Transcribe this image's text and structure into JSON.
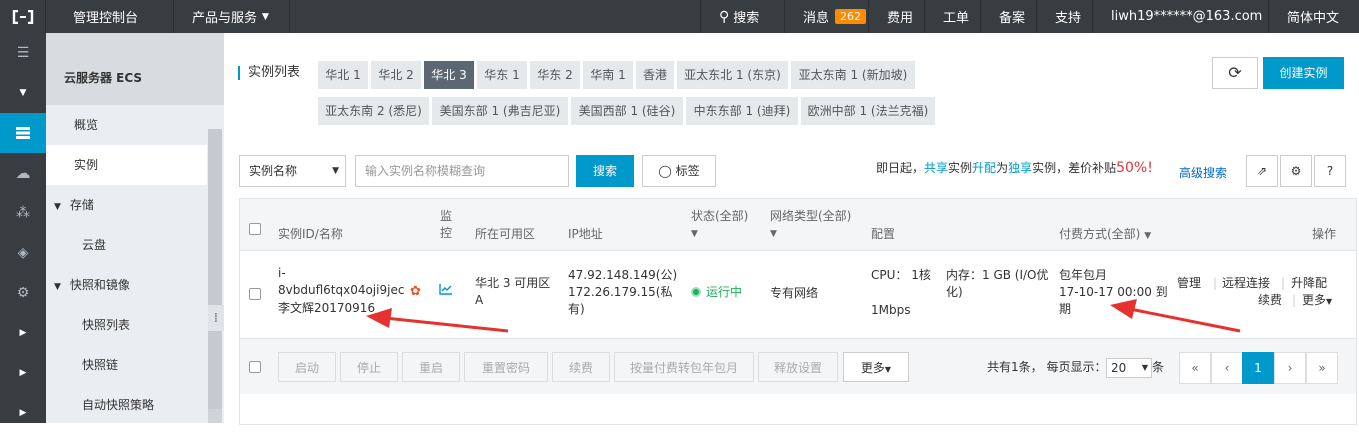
{
  "topbar": {
    "logo": "[-]",
    "brand": "管理控制台",
    "products": "产品与服务",
    "search": "搜索",
    "messages": "消息",
    "message_count": "262",
    "billing": "费用",
    "tickets": "工单",
    "beian": "备案",
    "support": "支持",
    "account": "liwh19******@163.com",
    "language": "简体中文"
  },
  "sidenav": {
    "title": "云服务器 ECS",
    "overview": "概览",
    "instances": "实例",
    "storage": "存储",
    "disk": "云盘",
    "snapshots": "快照和镜像",
    "snapshot_list": "快照列表",
    "snapshot_chain": "快照链",
    "auto_snapshot": "自动快照策略"
  },
  "regions": {
    "label": "实例列表",
    "row1": [
      "华北 1",
      "华北 2",
      "华北 3",
      "华东 1",
      "华东 2",
      "华南 1",
      "香港",
      "亚太东北 1 (东京)",
      "亚太东南 1 (新加坡)"
    ],
    "row2": [
      "亚太东南 2 (悉尼)",
      "美国东部 1 (弗吉尼亚)",
      "美国西部 1 (硅谷)",
      "中东东部 1 (迪拜)",
      "欧洲中部 1 (法兰克福)"
    ],
    "active": "华北 3"
  },
  "toolbar": {
    "refresh": "⟳",
    "create": "创建实例",
    "filter_select": "实例名称",
    "search_placeholder": "输入实例名称模糊查询",
    "search_btn": "搜索",
    "tag_btn": "标签",
    "promo_a": "即日起，",
    "promo_b": "共享",
    "promo_c": "实例",
    "promo_d": "升配",
    "promo_e": "为",
    "promo_f": "独享",
    "promo_g": "实例，差价补贴",
    "promo_pct": "50%!",
    "advanced": "高级搜索",
    "export_icon": "⇗",
    "gear_icon": "⚙",
    "help_icon": "?"
  },
  "table": {
    "headers": {
      "id": "实例ID/名称",
      "monitor": "监控",
      "zone": "所在可用区",
      "ip": "IP地址",
      "status": "状态(全部)",
      "network": "网络类型(全部)",
      "config": "配置",
      "billing": "付费方式(全部)",
      "actions": "操作"
    },
    "row": {
      "id_line1": "i-",
      "id_line2": "8vbdufl6tqx04oji9jec",
      "name": "李文辉20170916",
      "zone": "华北 3 可用区 A",
      "ip_public": "47.92.148.149(公)",
      "ip_private": "172.26.179.15(私有)",
      "status": "运行中",
      "network": "专有网络",
      "config_cpu": "CPU： 1核",
      "config_mem": "内存：1 GB (I/O优化)",
      "config_bw": "1Mbps",
      "billing_type": "包年包月",
      "billing_expire": "17-10-17 00:00 到期",
      "action_manage": "管理",
      "action_remote": "远程连接",
      "action_upgrade": "升降配",
      "action_renew": "续费",
      "action_more": "更多"
    }
  },
  "footer": {
    "buttons": [
      "启动",
      "停止",
      "重启",
      "重置密码",
      "续费",
      "按量付费转包年包月",
      "释放设置"
    ],
    "more": "更多",
    "total": "共有1条， 每页显示：",
    "page_size": "20",
    "unit": "条",
    "pages": [
      "«",
      "‹",
      "1",
      "›",
      "»"
    ]
  },
  "colors": {
    "accent": "#0099cc",
    "topbar": "#373d41",
    "annotation_arrow": "#e5312f"
  }
}
